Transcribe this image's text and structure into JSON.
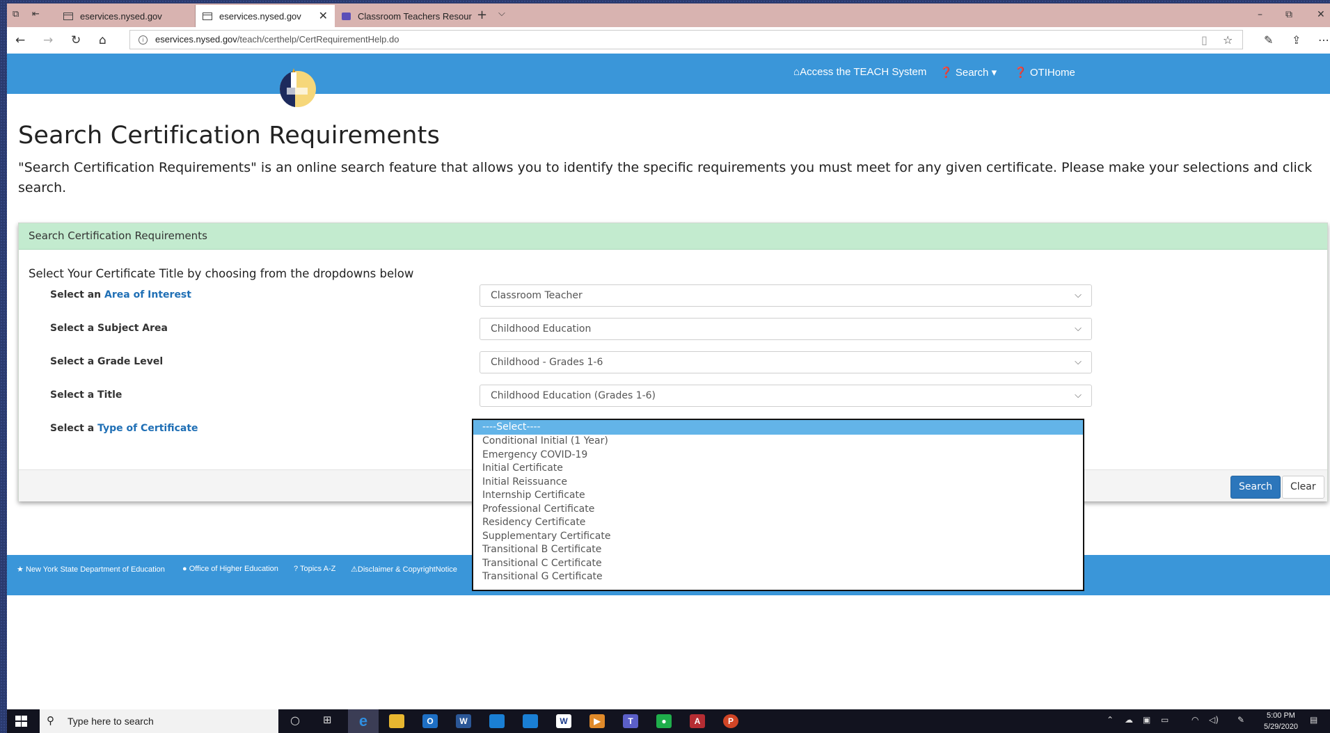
{
  "browser": {
    "tabs": [
      {
        "label": "eservices.nysed.gov"
      },
      {
        "label": "eservices.nysed.gov"
      },
      {
        "label": "Classroom Teachers Resour"
      }
    ],
    "url_host": "eservices.nysed.gov",
    "url_path": "/teach/certhelp/CertRequirementHelp.do"
  },
  "site": {
    "nav": {
      "access": "Access the TEACH System",
      "search": "Search",
      "oti": "OTIHome"
    }
  },
  "page": {
    "title": "Search Certification Requirements",
    "intro": "\"Search Certification Requirements\" is an online search feature that allows you to identify the specific requirements you must meet for any given certificate. Please make your selections and click search."
  },
  "panel": {
    "heading": "Search Certification Requirements",
    "subheading": "Select Your Certificate Title by choosing from the dropdowns below",
    "rows": [
      {
        "prefix": "Select an",
        "link": "Area of Interest",
        "value": "Classroom Teacher"
      },
      {
        "prefix": "Select a Subject Area",
        "link": "",
        "value": "Childhood Education"
      },
      {
        "prefix": "Select a Grade Level",
        "link": "",
        "value": "Childhood - Grades 1-6"
      },
      {
        "prefix": "Select a Title",
        "link": "",
        "value": "Childhood Education (Grades 1-6)"
      },
      {
        "prefix": "Select a",
        "link": "Type of Certificate",
        "value": "----Select----"
      }
    ],
    "search_button": "Search",
    "clear_button": "Clear"
  },
  "dropdown": {
    "options": [
      "----Select----",
      "Conditional Initial (1 Year)",
      "Emergency COVID-19",
      "Initial Certificate",
      "Initial Reissuance",
      "Internship Certificate",
      "Professional Certificate",
      "Residency Certificate",
      "Supplementary Certificate",
      "Transitional B Certificate",
      "Transitional C Certificate",
      "Transitional G Certificate"
    ]
  },
  "footer": {
    "links": [
      "New York State Department of Education",
      "Office of Higher Education",
      "Topics A-Z",
      "Disclaimer & CopyrightNotice"
    ]
  },
  "taskbar": {
    "search_placeholder": "Type here to search",
    "time": "5:00 PM",
    "date": "5/29/2020"
  },
  "colors": {
    "site_blue": "#3a96d9",
    "panel_head_green": "#c3ebcf",
    "link_blue": "#1f6fb5",
    "dropdown_highlight": "#63b4e8",
    "tabstrip": "#d8b3b0"
  }
}
